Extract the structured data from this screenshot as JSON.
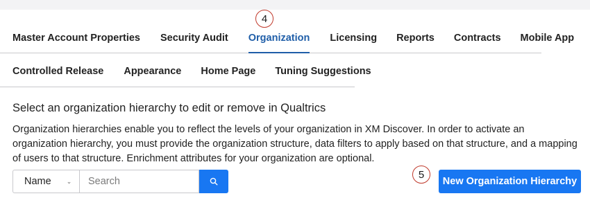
{
  "tabs_row1": [
    {
      "label": "Master Account Properties",
      "active": false
    },
    {
      "label": "Security Audit",
      "active": false
    },
    {
      "label": "Organization",
      "active": true
    },
    {
      "label": "Licensing",
      "active": false
    },
    {
      "label": "Reports",
      "active": false
    },
    {
      "label": "Contracts",
      "active": false
    },
    {
      "label": "Mobile App",
      "active": false
    }
  ],
  "tabs_row2": [
    {
      "label": "Controlled Release"
    },
    {
      "label": "Appearance"
    },
    {
      "label": "Home Page"
    },
    {
      "label": "Tuning Suggestions"
    }
  ],
  "callouts": {
    "organization_tab": "4",
    "new_button": "5"
  },
  "section": {
    "heading": "Select an organization hierarchy to edit or remove in Qualtrics",
    "description": "Organization hierarchies enable you to reflect the levels of your organization in XM Discover. In order to activate an organization hierarchy, you must provide the organization structure, data filters to apply based on that structure, and a mapping of users to that structure. Enrichment attributes for your organization are optional."
  },
  "search": {
    "filter_selected": "Name",
    "placeholder": "Search",
    "value": ""
  },
  "new_button_label": "New Organization Hierarchy",
  "colors": {
    "accent": "#1877f2",
    "active_tab": "#1f5ea8",
    "callout_border": "#c0392b"
  }
}
